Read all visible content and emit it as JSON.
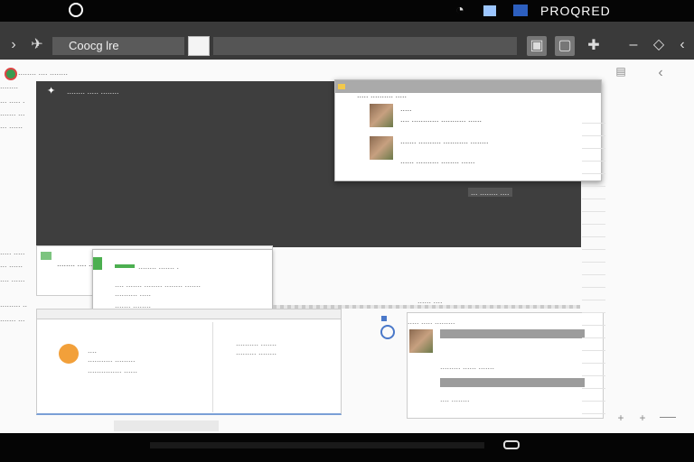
{
  "status_bar": {
    "right_text": "PROQRED",
    "icons": [
      "circle-icon",
      "shield-icon",
      "signal-icon",
      "battery-icon"
    ]
  },
  "toolbar": {
    "omnibox_text": "Coocg lre",
    "icons": [
      "chevron-right-icon",
      "navigate-icon",
      "tab-square-icon",
      "save-icon",
      "copy-icon",
      "plus-icon",
      "minus-icon",
      "diamond-icon",
      "back-icon"
    ]
  },
  "left_column": {
    "lines_top": [
      "........",
      "... ..... .",
      "....... ...",
      "... ......"
    ],
    "lines_bottom": [
      "..... .....",
      "... ......",
      ".... ......",
      "......... ..",
      "....... ..."
    ]
  },
  "panel": {
    "title": "........ ..... ........",
    "footer": "... ........ ...."
  },
  "popup": {
    "header": "..... .......... .....",
    "row1_title": ".....",
    "row1_sub": ".... ............ ........... ......",
    "row2_text": "....... .......... ........... ........",
    "row2_sub": "...... .......... ........ ......"
  },
  "card_left": {
    "title": "........ .... ....",
    "popup_title": "........ ....... .",
    "popup_lines": [
      ".... ....... ........ ........ .......",
      ".......... .....",
      "....... ........"
    ]
  },
  "strip_text": "...... ....",
  "lower_left": {
    "item_title": "....",
    "item_lines": [
      "........... .........",
      "............... ......"
    ],
    "right_lines": [
      ".......... .......",
      "......... ........"
    ]
  },
  "lower_right": {
    "header": "..... ..... .........",
    "mid_text": "......... ...... .......",
    "footer_text": ".... ........"
  },
  "colors": {
    "panel_bg": "#3e3e3e",
    "accent_green": "#4caf50",
    "accent_orange": "#f2a03a",
    "accent_blue": "#4a78c9"
  }
}
